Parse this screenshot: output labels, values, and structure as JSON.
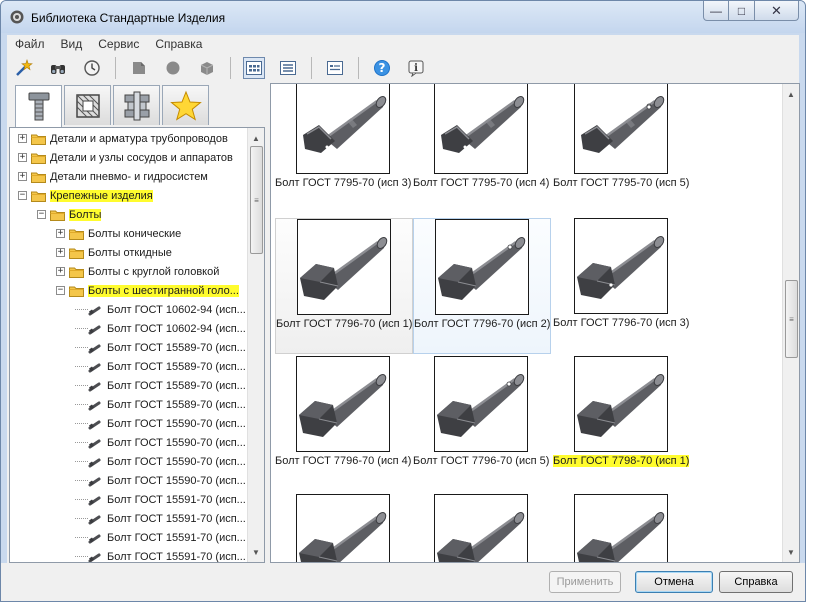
{
  "window": {
    "title": "Библиотека Стандартные Изделия",
    "min": "—",
    "max": "□",
    "close": "✕"
  },
  "menu": [
    "Файл",
    "Вид",
    "Сервис",
    "Справка"
  ],
  "toolbar": [
    {
      "icon": "wand-star-icon"
    },
    {
      "icon": "binoculars-icon"
    },
    {
      "icon": "history-clock-icon"
    },
    {
      "sep": true
    },
    {
      "icon": "component-icon"
    },
    {
      "icon": "circle-shape-icon"
    },
    {
      "icon": "cube-icon"
    },
    {
      "sep": true
    },
    {
      "icon": "large-icons-view-icon",
      "pressed": true
    },
    {
      "icon": "list-view-icon"
    },
    {
      "sep": true
    },
    {
      "icon": "details-view-icon"
    },
    {
      "sep": true
    },
    {
      "icon": "help-icon"
    },
    {
      "icon": "info-icon"
    }
  ],
  "tabs": [
    {
      "icon": "fastener-tab-icon",
      "active": true
    },
    {
      "icon": "sheet-tab-icon"
    },
    {
      "icon": "frame-tab-icon"
    },
    {
      "icon": "favorites-star-icon"
    }
  ],
  "tree": [
    {
      "label": "Детали и арматура трубопроводов",
      "level": 0,
      "expander": "+",
      "type": "folder"
    },
    {
      "label": "Детали и узлы сосудов и аппаратов",
      "level": 0,
      "expander": "+",
      "type": "folder"
    },
    {
      "label": "Детали пневмо- и гидросистем",
      "level": 0,
      "expander": "+",
      "type": "folder"
    },
    {
      "label": "Крепежные изделия",
      "level": 0,
      "expander": "-",
      "type": "folder",
      "hl": true
    },
    {
      "label": "Болты",
      "level": 1,
      "expander": "-",
      "type": "folder",
      "hl": true
    },
    {
      "label": "Болты конические",
      "level": 2,
      "expander": "+",
      "type": "folder"
    },
    {
      "label": "Болты откидные",
      "level": 2,
      "expander": "+",
      "type": "folder"
    },
    {
      "label": "Болты с круглой головкой",
      "level": 2,
      "expander": "+",
      "type": "folder"
    },
    {
      "label": "Болты с шестигранной голо...",
      "level": 2,
      "expander": "-",
      "type": "folder",
      "hl": true
    },
    {
      "label": "Болт ГОСТ 10602-94 (исп...",
      "level": 3,
      "type": "leaf"
    },
    {
      "label": "Болт ГОСТ 10602-94 (исп...",
      "level": 3,
      "type": "leaf"
    },
    {
      "label": "Болт ГОСТ 15589-70 (исп...",
      "level": 3,
      "type": "leaf"
    },
    {
      "label": "Болт ГОСТ 15589-70 (исп...",
      "level": 3,
      "type": "leaf"
    },
    {
      "label": "Болт ГОСТ 15589-70 (исп...",
      "level": 3,
      "type": "leaf"
    },
    {
      "label": "Болт ГОСТ 15589-70 (исп...",
      "level": 3,
      "type": "leaf"
    },
    {
      "label": "Болт ГОСТ 15590-70 (исп...",
      "level": 3,
      "type": "leaf"
    },
    {
      "label": "Болт ГОСТ 15590-70 (исп...",
      "level": 3,
      "type": "leaf"
    },
    {
      "label": "Болт ГОСТ 15590-70 (исп...",
      "level": 3,
      "type": "leaf"
    },
    {
      "label": "Болт ГОСТ 15590-70 (исп...",
      "level": 3,
      "type": "leaf"
    },
    {
      "label": "Болт ГОСТ 15591-70 (исп...",
      "level": 3,
      "type": "leaf"
    },
    {
      "label": "Болт ГОСТ 15591-70 (исп...",
      "level": 3,
      "type": "leaf"
    },
    {
      "label": "Болт ГОСТ 15591-70 (исп...",
      "level": 3,
      "type": "leaf"
    },
    {
      "label": "Болт ГОСТ 15591-70 (исп...",
      "level": 3,
      "type": "leaf"
    }
  ],
  "gallery": [
    {
      "label": "Болт ГОСТ 7795-70 (исп 3)",
      "variant": "cut"
    },
    {
      "label": "Болт ГОСТ 7795-70 (исп 4)",
      "variant": "cut"
    },
    {
      "label": "Болт ГОСТ 7795-70 (исп 5)",
      "variant": "cut-hole"
    },
    {
      "label": "Болт ГОСТ 7796-70 (исп 1)",
      "variant": "hex",
      "state": "hover2"
    },
    {
      "label": "Болт ГОСТ 7796-70 (исп 2)",
      "variant": "hex-hole",
      "state": "hover"
    },
    {
      "label": "Болт ГОСТ 7796-70 (исп 3)",
      "variant": "hex-dot"
    },
    {
      "label": "Болт ГОСТ 7796-70 (исп 4)",
      "variant": "hex"
    },
    {
      "label": "Болт ГОСТ 7796-70 (исп 5)",
      "variant": "hex-hole"
    },
    {
      "label": "Болт ГОСТ 7798-70 (исп 1)",
      "variant": "hex",
      "hl": true
    },
    {
      "label": "",
      "variant": "hex"
    },
    {
      "label": "",
      "variant": "hex"
    },
    {
      "label": "",
      "variant": "hex"
    }
  ],
  "buttons": {
    "apply": "Применить",
    "cancel": "Отмена",
    "help": "Справка"
  },
  "colors": {
    "highlight": "#fffc2e",
    "folder": "#f4c64a",
    "bolt": "#5d5e63"
  }
}
